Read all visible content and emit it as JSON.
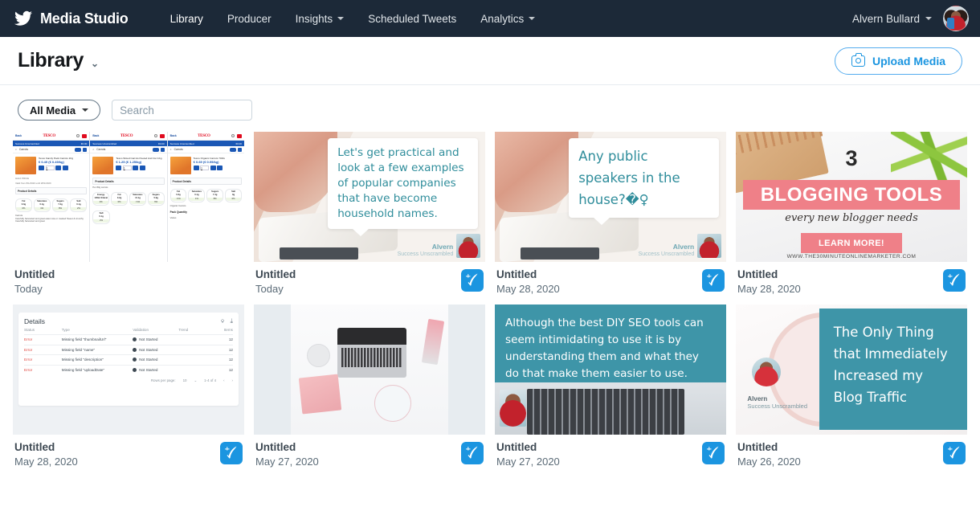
{
  "topnav": {
    "brand": "Media Studio",
    "brand_icon": "twitter-bird-icon",
    "links": [
      {
        "label": "Library",
        "has_caret": false
      },
      {
        "label": "Producer",
        "has_caret": false
      },
      {
        "label": "Insights",
        "has_caret": true
      },
      {
        "label": "Scheduled Tweets",
        "has_caret": false
      },
      {
        "label": "Analytics",
        "has_caret": true
      }
    ],
    "account_name": "Alvern Bullard",
    "accent": "#1b95e0",
    "background": "#1c2938"
  },
  "header": {
    "title": "Library",
    "upload_label": "Upload Media",
    "upload_icon": "camera-icon"
  },
  "filters": {
    "media_filter_label": "All Media",
    "search_placeholder": "Search",
    "search_value": ""
  },
  "media": [
    {
      "art": "tesco",
      "title": "Untitled",
      "date": "Today",
      "tesco": {
        "back_label": "Back",
        "logo": "TESCO",
        "bar_label": "Success Unscrambled",
        "bar_price": "€0.00",
        "search_term": "Carrots",
        "panels": [
          {
            "name": "Tesco Family Pack Carrots 1Kg",
            "price": "€ 0.49 (€ 0.49/kg)",
            "qty": "1",
            "half_price": "HALF PRICE",
            "valid": "Valid from 8/1/2020 until 28/1/2020",
            "details_label": "Product Details",
            "nutrients": [
              {
                "label": "Fat",
                "amount": "0.3g",
                "pct": "0%"
              },
              {
                "label": "Saturates",
                "amount": "0.1g",
                "pct": "1%"
              },
              {
                "label": "Sugars",
                "amount": "7.4g",
                "pct": "8%"
              },
              {
                "label": "Salt",
                "amount": "0.1g",
                "pct": "2%"
              }
            ],
            "desc_title": "Carrots",
            "desc": "Carefully harvested and great eaten raw or roasted Sweet & crunchy Carefully harvested and great"
          },
          {
            "name": "Tesco Sliced Carrots Peeled And Cut 1Kg",
            "price": "€ 1.25 (€ 1.25/kg)",
            "qty": "1",
            "details_label": "Product Details",
            "per_label": "Per 80g carrots",
            "nutrients": [
              {
                "label": "Energy",
                "amount": "135kJ 31kcal",
                "pct": "2%"
              },
              {
                "label": "Fat",
                "amount": "0.2g",
                "pct": "0%"
              },
              {
                "label": "Saturates",
                "amount": "<0.1g",
                "pct": "<1%"
              },
              {
                "label": "Sugars",
                "amount": "5.9g",
                "pct": "6%"
              },
              {
                "label": "Salt",
                "amount": "0.1g",
                "pct": "2%"
              }
            ]
          },
          {
            "name": "Tesco Organic Carrots 700G",
            "price": "€ 0.69 (€ 0.99/kg)",
            "qty": "1",
            "details_label": "Product Details",
            "nutrients": [
              {
                "label": "Fat",
                "amount": "0.3g",
                "pct": "<1%"
              },
              {
                "label": "Saturates",
                "amount": "0.1g",
                "pct": "1%"
              },
              {
                "label": "Sugars",
                "amount": "7.4g",
                "pct": "8%"
              },
              {
                "label": "Salt",
                "amount": "0g",
                "pct": "0%"
              }
            ],
            "desc_title": "Organic Carrots",
            "pack_title": "Pack Quantity",
            "pack_value": "Varies"
          }
        ]
      }
    },
    {
      "art": "quote",
      "title": "Untitled",
      "date": "Today",
      "quote": "Let's get practical and look at a few examples of popular companies that have become household names.",
      "quote_size": "small",
      "sig_name": "Alvern",
      "sig_sub": "Success Unscrambled"
    },
    {
      "art": "quote",
      "title": "Untitled",
      "date": "May 28, 2020",
      "quote": "Any public speakers in the house?�♀",
      "quote_size": "big",
      "sig_name": "Alvern",
      "sig_sub": "Success Unscrambled"
    },
    {
      "art": "blogging",
      "title": "Untitled",
      "date": "May 28, 2020",
      "blog": {
        "number": "3",
        "headline": "BLOGGING TOOLS",
        "subline": "every new blogger needs",
        "cta": "LEARN MORE!",
        "url": "WWW.THE30MINUTEONLINEMARKETER.COM"
      }
    },
    {
      "art": "details-table",
      "title": "Untitled",
      "date": "May 28, 2020",
      "table": {
        "heading": "Details",
        "icons": [
          "filter-icon",
          "download-icon"
        ],
        "columns": [
          "Status",
          "Type",
          "Validation",
          "Trend",
          "Items"
        ],
        "rows": [
          {
            "status": "Error",
            "type": "Missing field \"thumbnailUrl\"",
            "validation": "Not Started",
            "items": "12"
          },
          {
            "status": "Error",
            "type": "Missing field \"name\"",
            "validation": "Not Started",
            "items": "12"
          },
          {
            "status": "Error",
            "type": "Missing field \"description\"",
            "validation": "Not Started",
            "items": "12"
          },
          {
            "status": "Error",
            "type": "Missing field \"uploadDate\"",
            "validation": "Not Started",
            "items": "12"
          }
        ],
        "rows_per_page_label": "Rows per page:",
        "rows_per_page_value": "10",
        "range": "1-4 of 4"
      }
    },
    {
      "art": "desk",
      "title": "Untitled",
      "date": "May 27, 2020"
    },
    {
      "art": "teal-top",
      "title": "Untitled",
      "date": "May 27, 2020",
      "quote": "Although the best DIY SEO tools can seem intimidating to use it is by understanding them and what they do that make them easier to use."
    },
    {
      "art": "teal-right",
      "title": "Untitled",
      "date": "May 26, 2020",
      "quote": "The Only Thing that Immediately Increased my Blog Traffic",
      "sig_name": "Alvern",
      "sig_sub": "Success Unscrambled"
    }
  ],
  "compose_icon": "compose-tweet-icon",
  "colors": {
    "nav_bg": "#1c2938",
    "accent_blue": "#1b95e0",
    "teal": "#3e95a8",
    "quote_teal": "#2f8d9b",
    "pink": "#ef8088",
    "error_red": "#e0443e"
  }
}
